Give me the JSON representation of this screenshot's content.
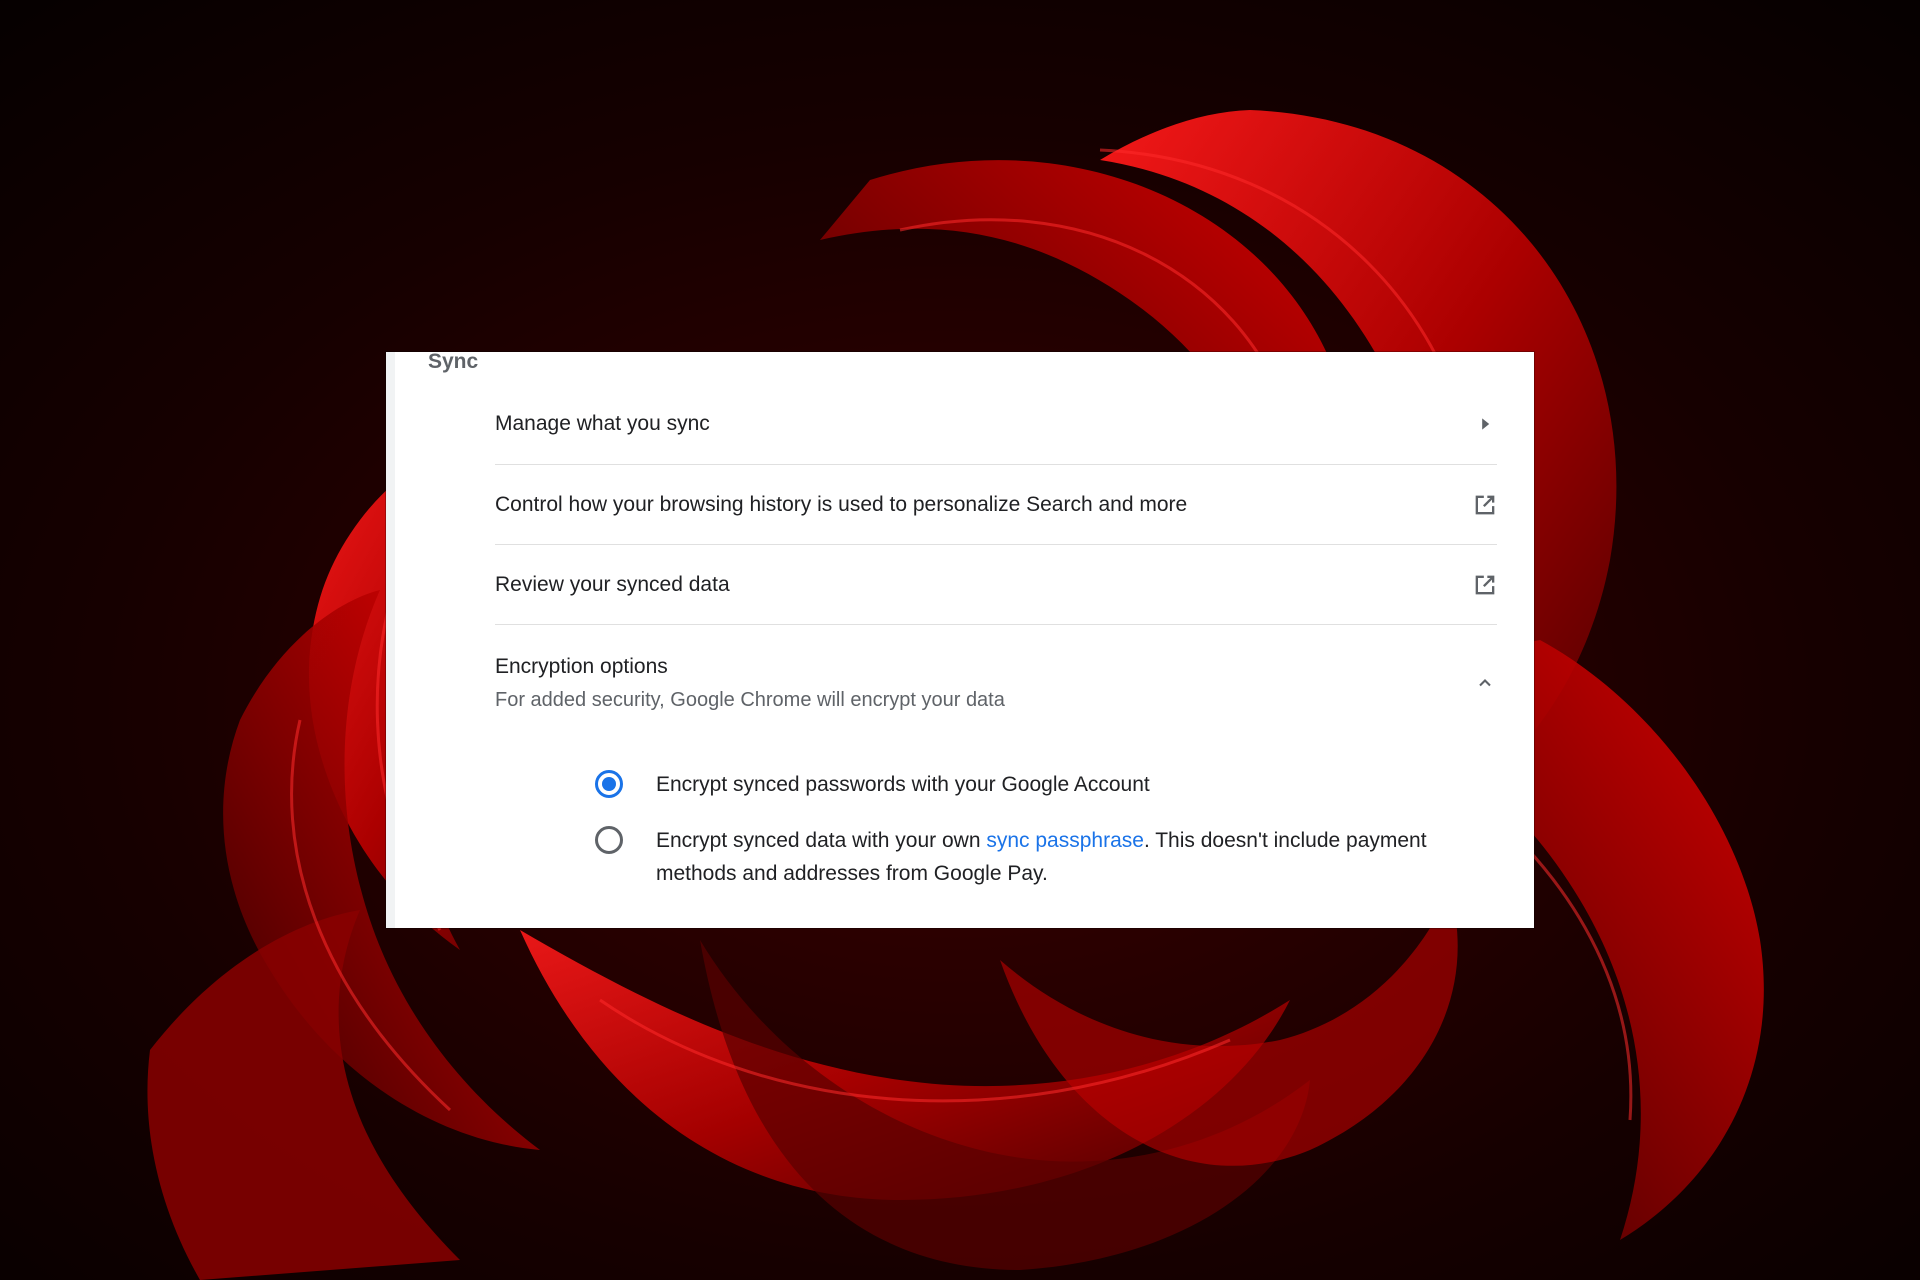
{
  "section": {
    "title": "Sync"
  },
  "rows": {
    "manage": {
      "label": "Manage what you sync",
      "icon": "chevron-right-icon"
    },
    "history": {
      "label": "Control how your browsing history is used to personalize Search and more",
      "icon": "open-in-new-icon"
    },
    "review": {
      "label": "Review your synced data",
      "icon": "open-in-new-icon"
    },
    "encryption": {
      "title": "Encryption options",
      "subtitle": "For added security, Google Chrome will encrypt your data",
      "icon": "chevron-up-icon",
      "expanded": true
    }
  },
  "encryption_options": {
    "option_1": {
      "label": "Encrypt synced passwords with your Google Account",
      "selected": true
    },
    "option_2": {
      "text_before": "Encrypt synced data with your own ",
      "link": "sync passphrase",
      "text_after": ". This doesn't include payment methods and addresses from Google Pay.",
      "selected": false
    }
  },
  "colors": {
    "accent": "#1a73e8",
    "primary_text": "#202124",
    "secondary_text": "#5f6368",
    "wallpaper": "#c00000"
  }
}
